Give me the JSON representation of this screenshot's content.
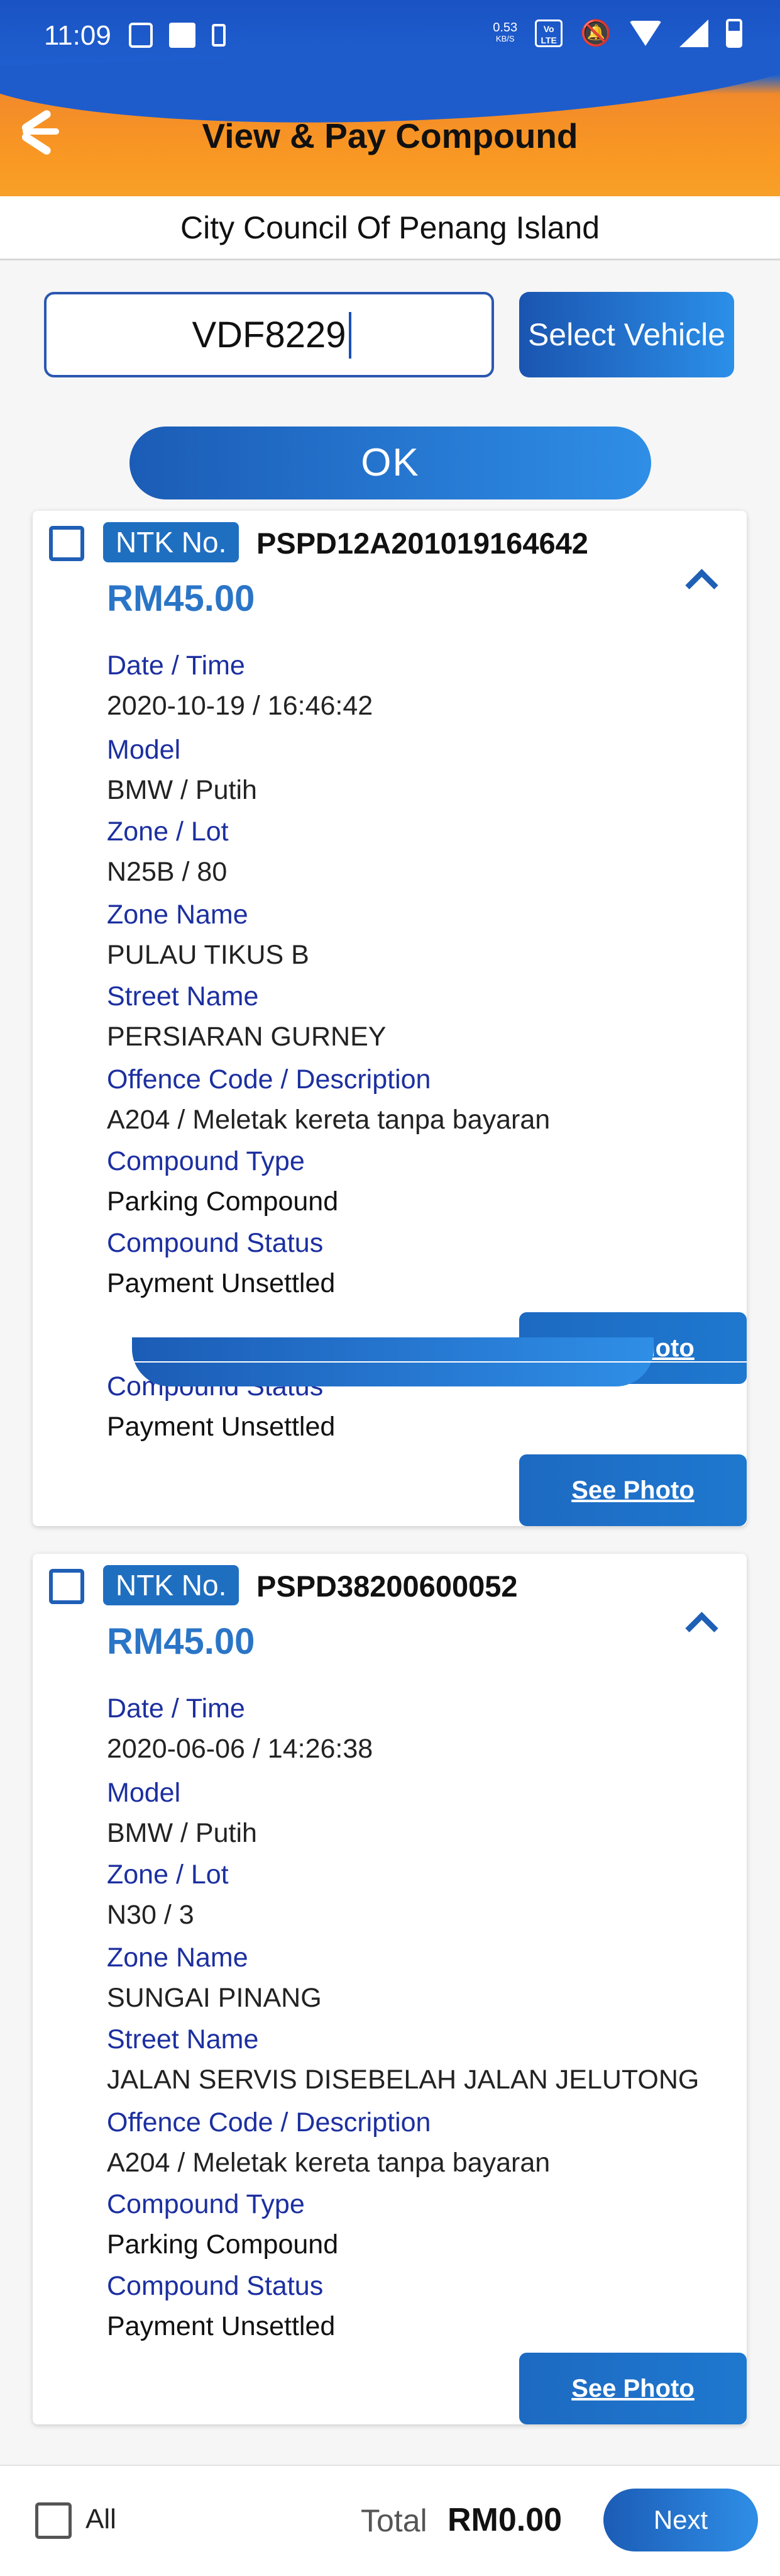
{
  "status_bar": {
    "time": "11:09",
    "net_speed": "0.53",
    "net_unit": "KB/S",
    "lte": "Vo LTE"
  },
  "header": {
    "title": "View & Pay Compound"
  },
  "council": "City Council Of Penang Island",
  "search": {
    "plate_value": "VDF8229",
    "select_vehicle_label": "Select Vehicle",
    "ok_label": "OK"
  },
  "compounds": [
    {
      "ntk_label": "NTK No.",
      "ntk_number": "PSPD12A201019164642",
      "amount": "RM45.00",
      "fields": {
        "datetime_label": "Date / Time",
        "datetime": "2020-10-19 / 16:46:42",
        "model_label": "Model",
        "model": "BMW / Putih",
        "zone_lot_label": "Zone / Lot",
        "zone_lot": "N25B / 80",
        "zone_name_label": "Zone Name",
        "zone_name": "PULAU TIKUS B",
        "street_label": "Street Name",
        "street": "PERSIARAN GURNEY",
        "offence_label": "Offence Code / Description",
        "offence": "A204 / Meletak kereta tanpa bayaran",
        "type_label": "Compound Type",
        "type": "Parking Compound",
        "status_label": "Compound Status",
        "status": "Payment Unsettled"
      },
      "photo_label": "See Photo"
    },
    {
      "ntk_label": "NTK No.",
      "ntk_number": "PSPD38200600052",
      "amount": "RM45.00",
      "fields": {
        "datetime_label": "Date / Time",
        "datetime": "2020-06-06 / 14:26:38",
        "model_label": "Model",
        "model": "BMW / Putih",
        "zone_lot_label": "Zone / Lot",
        "zone_lot": "N30 / 3",
        "zone_name_label": "Zone Name",
        "zone_name": "SUNGAI PINANG",
        "street_label": "Street Name",
        "street": "JALAN SERVIS DISEBELAH JALAN JELUTONG",
        "offence_label": "Offence Code / Description",
        "offence": "A204 / Meletak kereta tanpa bayaran",
        "type_label": "Compound Type",
        "type": "Parking Compound",
        "status_label": "Compound Status",
        "status": "Payment Unsettled"
      },
      "photo_label": "See Photo"
    }
  ],
  "ghost": {
    "status_label": "Compound Status",
    "status": "Payment Unsettled",
    "photo_label": "See Photo"
  },
  "footer": {
    "all_label": "All",
    "total_label": "Total",
    "total_value": "RM0.00",
    "next_label": "Next"
  }
}
